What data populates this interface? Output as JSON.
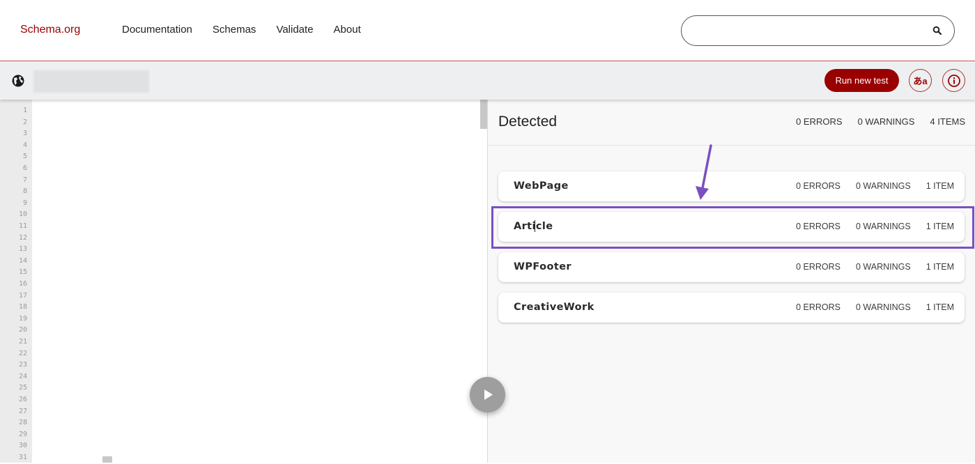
{
  "header": {
    "brand": "Schema.org",
    "nav": [
      "Documentation",
      "Schemas",
      "Validate",
      "About"
    ],
    "search": {
      "value": "",
      "placeholder": "",
      "icon": "search-icon"
    }
  },
  "toolbar": {
    "url_icon": "globe-icon",
    "url_value": "",
    "run_label": "Run new test",
    "lang_label": "あa",
    "info_label": "i"
  },
  "editor": {
    "line_count": 31,
    "lines": [
      "1",
      "2",
      "3",
      "4",
      "5",
      "6",
      "7",
      "8",
      "9",
      "10",
      "11",
      "12",
      "13",
      "14",
      "15",
      "16",
      "17",
      "18",
      "19",
      "20",
      "21",
      "22",
      "23",
      "24",
      "25",
      "26",
      "27",
      "28",
      "29",
      "30",
      "31"
    ]
  },
  "results": {
    "title": "Detected",
    "summary": {
      "errors": "0 ERRORS",
      "warnings": "0 WARNINGS",
      "items": "4 ITEMS"
    },
    "cards": [
      {
        "name": "WebPage",
        "errors": "0 ERRORS",
        "warnings": "0 WARNINGS",
        "items": "1 ITEM"
      },
      {
        "name": "Article",
        "errors": "0 ERRORS",
        "warnings": "0 WARNINGS",
        "items": "1 ITEM"
      },
      {
        "name": "WPFooter",
        "errors": "0 ERRORS",
        "warnings": "0 WARNINGS",
        "items": "1 ITEM"
      },
      {
        "name": "CreativeWork",
        "errors": "0 ERRORS",
        "warnings": "0 WARNINGS",
        "items": "1 ITEM"
      }
    ],
    "highlighted_card": "Article"
  },
  "colors": {
    "brand": "#990000",
    "annotation": "#7b4fc0"
  }
}
